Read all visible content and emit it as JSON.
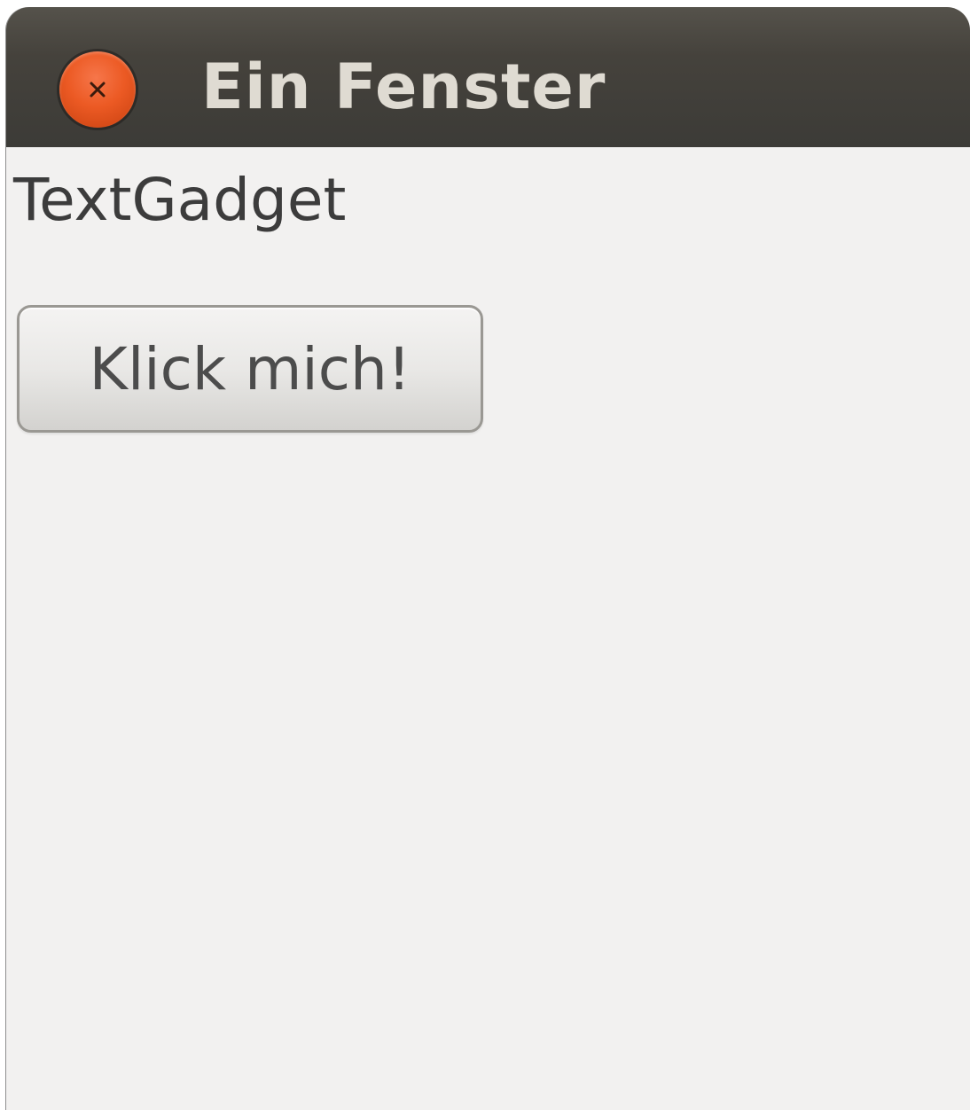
{
  "window": {
    "title": "Ein Fenster"
  },
  "content": {
    "text_gadget": "TextGadget",
    "button_label": "Klick mich!"
  },
  "icons": {
    "close": "close-icon"
  },
  "colors": {
    "titlebar": "#3c3b37",
    "close_button": "#ec5a24",
    "background": "#f2f1f0"
  }
}
